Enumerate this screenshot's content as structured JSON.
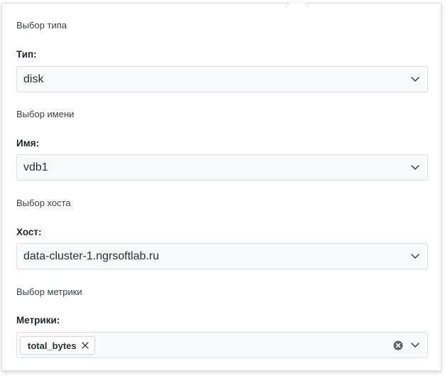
{
  "type_section": {
    "title": "Выбор типа",
    "label": "Тип:",
    "value": "disk"
  },
  "name_section": {
    "title": "Выбор имени",
    "label": "Имя:",
    "value": "vdb1"
  },
  "host_section": {
    "title": "Выбор хоста",
    "label": "Хост:",
    "value": "data-cluster-1.ngrsoftlab.ru"
  },
  "metric_section": {
    "title": "Выбор метрики",
    "label": "Метрики:",
    "selected_tags": [
      "total_bytes"
    ]
  },
  "icons": {
    "chevron": "chevron-down-icon",
    "clear": "clear-circle-icon",
    "tag_remove": "close-icon"
  },
  "colors": {
    "field_background": "#f7f9fb",
    "field_border": "#dbe0e5",
    "text": "#2b2f33"
  }
}
